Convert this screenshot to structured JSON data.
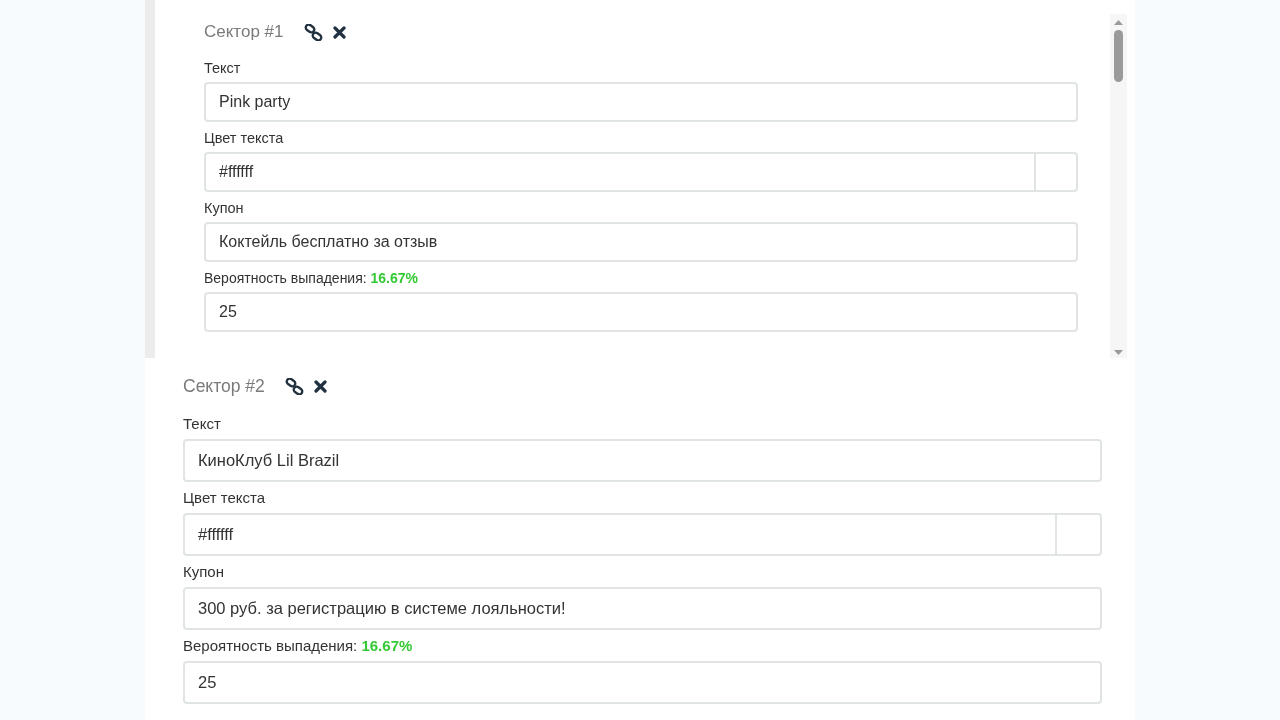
{
  "scroll_panel": {
    "sectors": [
      {
        "title": "Сектор #1",
        "fields": [
          {
            "kind": "text",
            "label": "Текст",
            "value": "Pink party"
          },
          {
            "kind": "color",
            "label": "Цвет текста",
            "value": "#ffffff"
          },
          {
            "kind": "text",
            "label": "Купон",
            "value": "Коктейль бесплатно за отзыв"
          },
          {
            "kind": "weight",
            "label": "Вероятность выпадения:",
            "percent": "16.67%",
            "value": "25"
          }
        ]
      }
    ]
  },
  "sectors": [
    {
      "title": "Сектор #2",
      "fields": [
        {
          "kind": "text",
          "label": "Текст",
          "value": "КиноКлуб Lil Brazil"
        },
        {
          "kind": "color",
          "label": "Цвет текста",
          "value": "#ffffff"
        },
        {
          "kind": "text",
          "label": "Купон",
          "value": "300 руб. за регистрацию в системе лояльности!"
        },
        {
          "kind": "weight",
          "label": "Вероятность выпадения:",
          "percent": "16.67%",
          "value": "25"
        }
      ]
    }
  ]
}
